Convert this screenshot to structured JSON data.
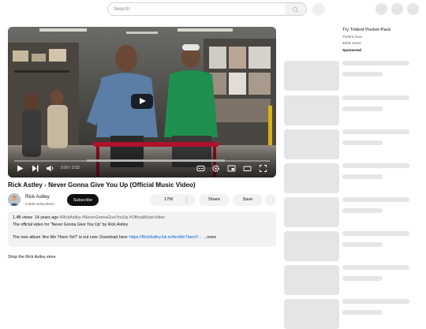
{
  "search": {
    "placeholder": "Search"
  },
  "player": {
    "time": "0:00 / 3:33",
    "icons": [
      "play-icon",
      "next-icon",
      "volume-icon",
      "subtitles-icon",
      "settings-icon",
      "miniplayer-icon",
      "theater-icon",
      "fullscreen-icon"
    ]
  },
  "video": {
    "title": "Rick Astley - Never Gonna Give You Up (Official Music Video)",
    "channel": "Rick Astley",
    "subscribers": "3.96M subscribers",
    "subscribe_label": "Subscribe",
    "likes": "17M",
    "share_label": "Share",
    "save_label": "Save"
  },
  "description": {
    "views": "1.4B views",
    "age": "14 years ago",
    "tags": "#RickAstley #NeverGonnaGiveYouUp #OfficialMusicVideo",
    "line1": "The official video for “Never Gonna Give You Up” by Rick Astley.",
    "line2_prefix": "The new album 'Are We There Yet?' is out now: Download here:",
    "line2_link": "https://RickAstley.lnk.to/AreWeThereY...",
    "more_label": "...more"
  },
  "shop_label": "Shop the Rick Astley store",
  "ad": {
    "title": "Try Trident Pocket Pack",
    "brand": "Trident Gum",
    "views": "480K views",
    "sponsored": "Sponsored"
  },
  "colors": {
    "subscribe_bg": "#0f0f0f",
    "link": "#065fd4",
    "placeholder_gray": "#e5e5e5"
  }
}
